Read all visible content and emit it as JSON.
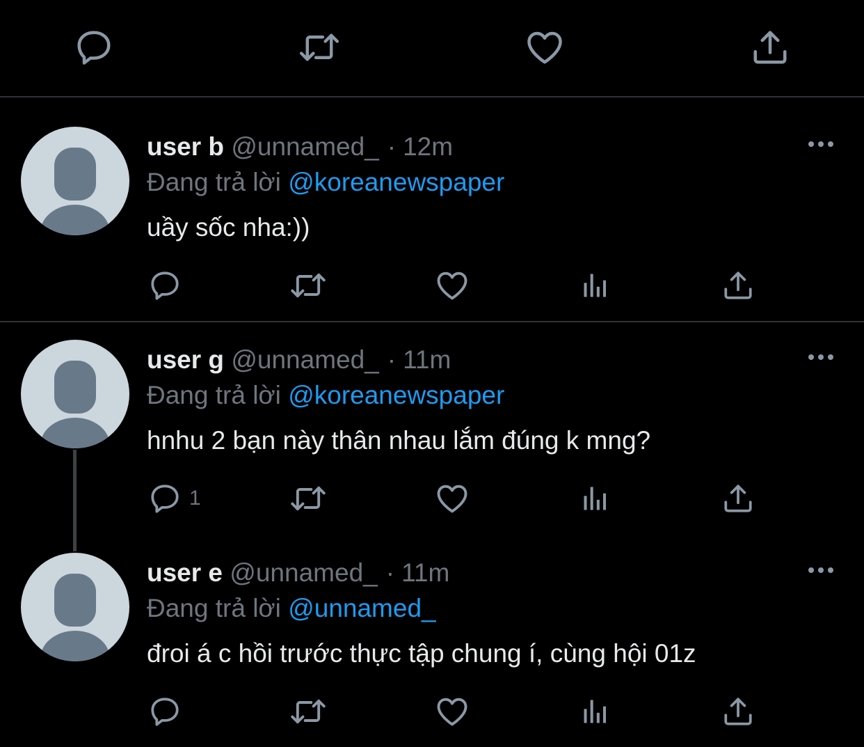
{
  "top_bar": {
    "icons": [
      "reply-icon",
      "retweet-icon",
      "like-icon",
      "share-icon"
    ]
  },
  "colors": {
    "background": "#000000",
    "text_primary": "#e7e9ea",
    "text_secondary": "#6e767d",
    "link": "#1d9bf0",
    "divider": "#2f3336",
    "avatar_bg": "#ccd6dd",
    "avatar_fg": "#68798a"
  },
  "reply_prefix": "Đang trả lời",
  "tweets": [
    {
      "display_name": "user b",
      "handle": "@unnamed_",
      "separator": "·",
      "time": "12m",
      "reply_to": "@koreanewspaper",
      "text": "uầy sốc nha:))",
      "reply_count": ""
    },
    {
      "display_name": "user g",
      "handle": "@unnamed_",
      "separator": "·",
      "time": "11m",
      "reply_to": "@koreanewspaper",
      "text": "hnhu 2 bạn này thân nhau lắm đúng k mng?",
      "reply_count": "1"
    },
    {
      "display_name": "user e",
      "handle": "@unnamed_",
      "separator": "·",
      "time": "11m",
      "reply_to": "@unnamed_",
      "text": "đroi á c hồi trước thực tập chung í, cùng hội 01z",
      "reply_count": ""
    }
  ]
}
